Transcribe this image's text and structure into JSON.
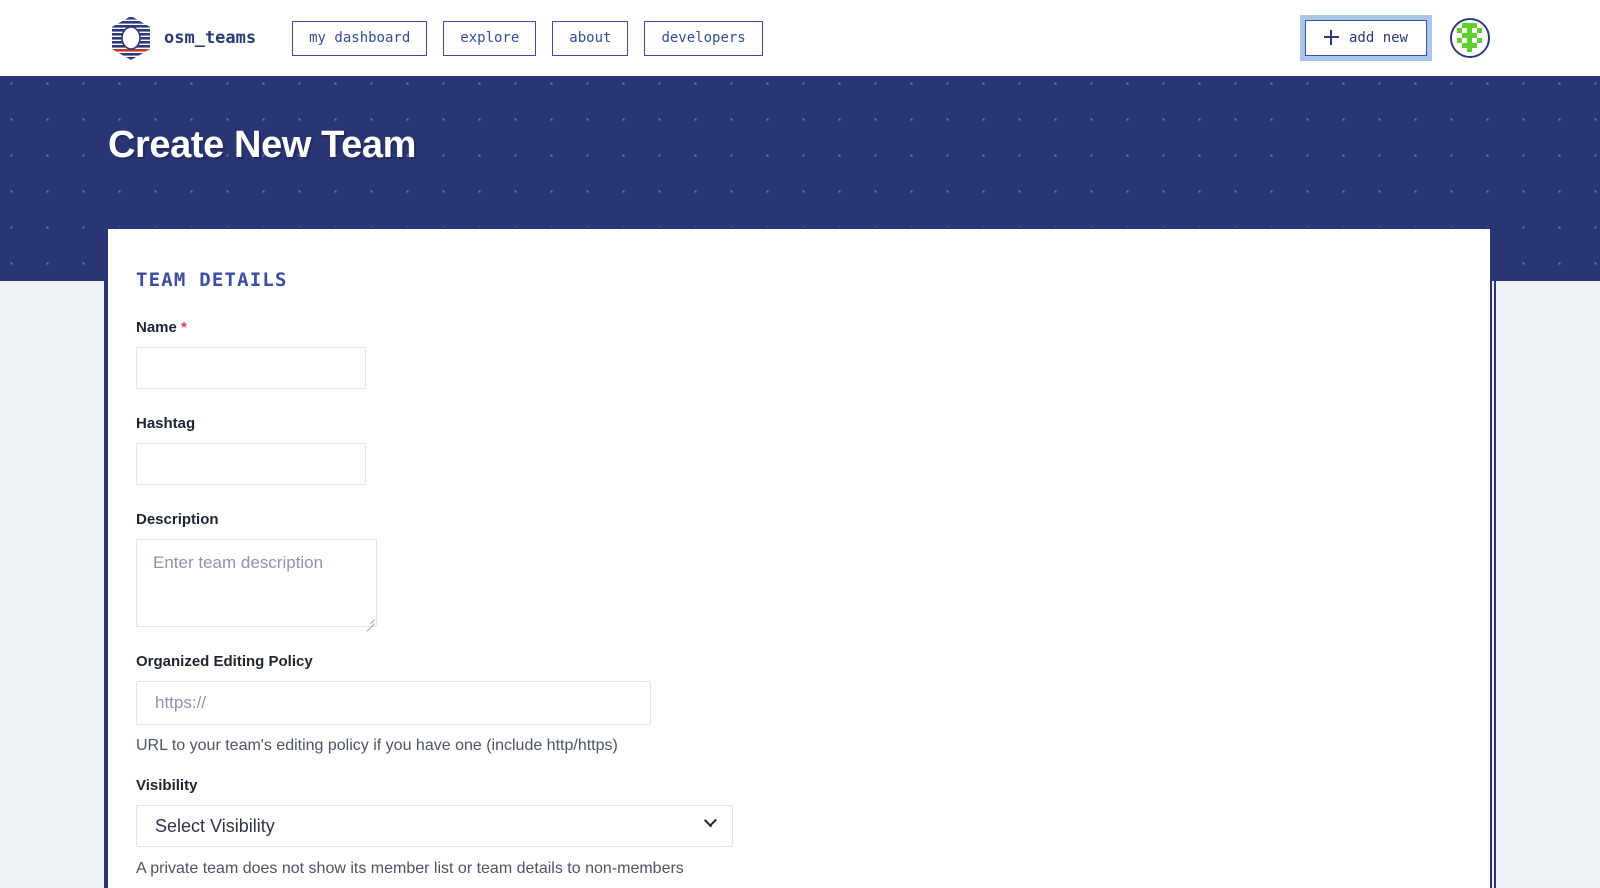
{
  "header": {
    "logo_icon": "osm-teams-hexagon-logo",
    "brand_name": "osm_teams",
    "nav_items": [
      {
        "label": "my dashboard",
        "name": "nav-my-dashboard"
      },
      {
        "label": "explore",
        "name": "nav-explore"
      },
      {
        "label": "about",
        "name": "nav-about"
      },
      {
        "label": "developers",
        "name": "nav-developers"
      }
    ],
    "add_new_label": "add new",
    "add_new_icon": "plus-icon",
    "avatar_icon": "user-avatar-identicon"
  },
  "banner": {
    "title": "Create New Team"
  },
  "form": {
    "section_title": "TEAM DETAILS",
    "name": {
      "label": "Name",
      "required_marker": "*",
      "value": "",
      "placeholder": ""
    },
    "hashtag": {
      "label": "Hashtag",
      "value": "",
      "placeholder": ""
    },
    "description": {
      "label": "Description",
      "value": "",
      "placeholder": "Enter team description"
    },
    "editing_policy": {
      "label": "Organized Editing Policy",
      "value": "",
      "placeholder": "https://",
      "help": "URL to your team's editing policy if you have one (include http/https)"
    },
    "visibility": {
      "label": "Visibility",
      "selected": "Select Visibility",
      "chevron_icon": "chevron-down-icon",
      "help": "A private team does not show its member list or team details to non-members"
    }
  },
  "colors": {
    "brand_blue": "#2a3573",
    "accent_blue": "#3b4ea3",
    "page_bg": "#edf0f4",
    "required_red": "#e8384f",
    "avatar_green": "#5fd12e",
    "focus_ring": "#a8c6e8"
  }
}
